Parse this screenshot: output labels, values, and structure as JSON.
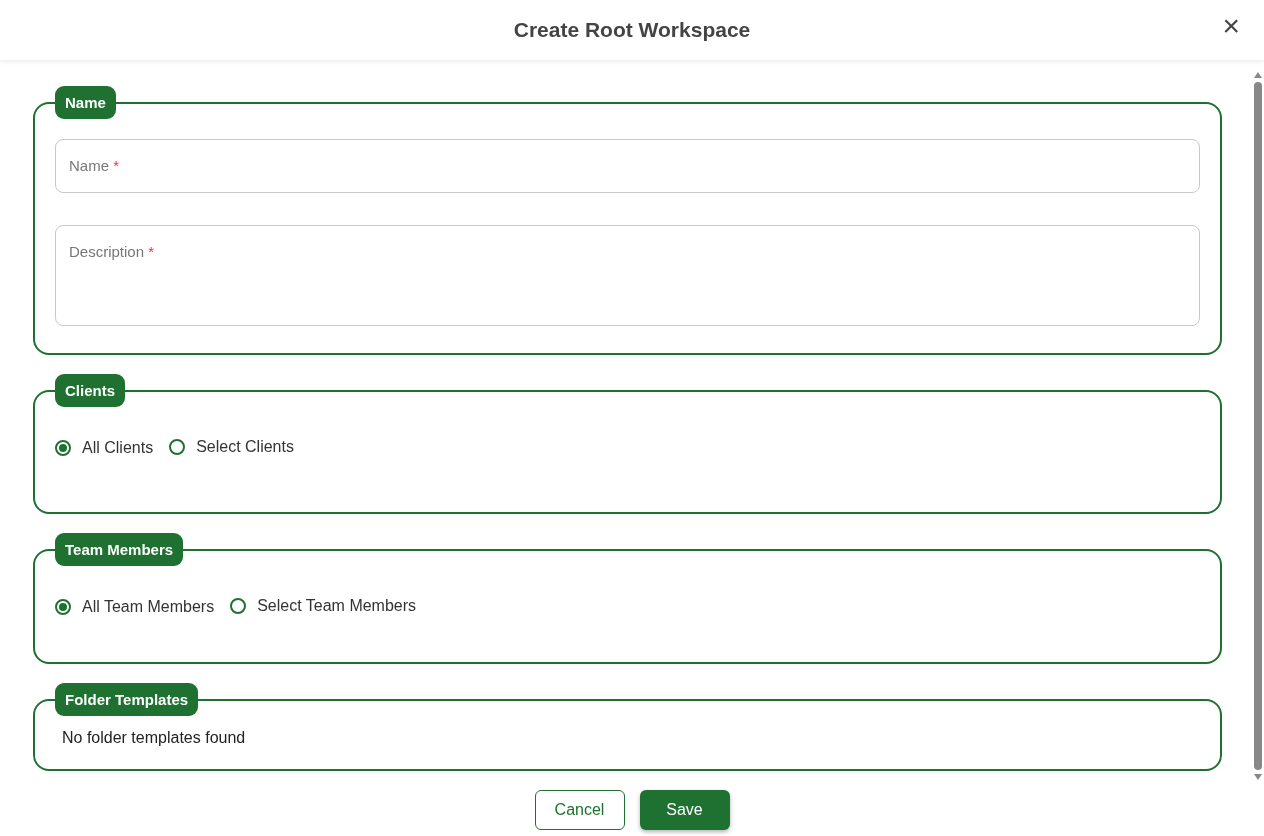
{
  "dialog": {
    "title": "Create Root Workspace",
    "close_label": "×"
  },
  "sections": [
    {
      "kind": "fields",
      "legend": "Name",
      "fields": [
        {
          "label": "Name",
          "required_mark": "*",
          "multiline": false
        },
        {
          "label": "Description",
          "required_mark": "*",
          "multiline": true
        }
      ]
    },
    {
      "kind": "radios",
      "legend": "Clients",
      "options": [
        {
          "label": "All Clients",
          "selected": true
        },
        {
          "label": "Select Clients",
          "selected": false
        }
      ]
    },
    {
      "kind": "radios",
      "legend": "Team Members",
      "options": [
        {
          "label": "All Team Members",
          "selected": true
        },
        {
          "label": "Select Team Members",
          "selected": false
        }
      ]
    },
    {
      "kind": "message",
      "legend": "Folder Templates",
      "text": "No folder templates found"
    }
  ],
  "buttons": [
    {
      "label": "Cancel",
      "kind": "secondary"
    },
    {
      "label": "Save",
      "kind": "primary"
    }
  ]
}
